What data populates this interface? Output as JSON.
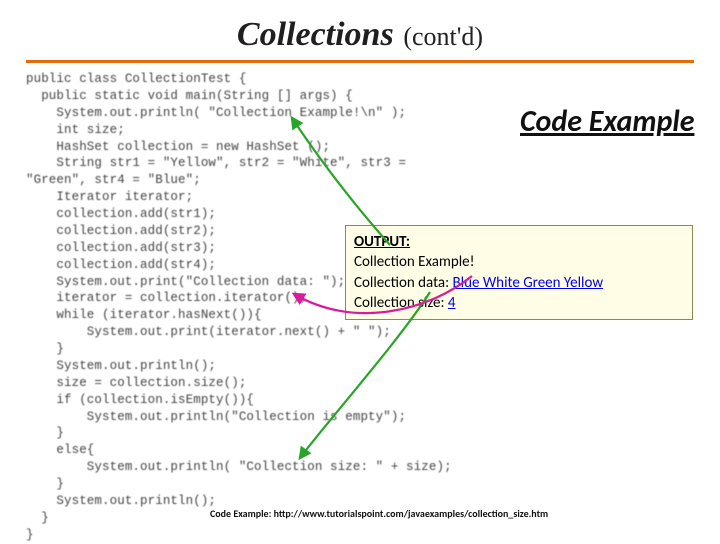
{
  "title": {
    "main": "Collections",
    "sub": "(cont'd)"
  },
  "heading_code_example": "Code\nExample",
  "code": "public class CollectionTest {\n  public static void main(String [] args) {\n    System.out.println( \"Collection Example!\\n\" );\n    int size;\n    HashSet collection = new HashSet ();\n    String str1 = \"Yellow\", str2 = \"White\", str3 =\n\"Green\", str4 = \"Blue\";\n    Iterator iterator;\n    collection.add(str1);\n    collection.add(str2);\n    collection.add(str3);\n    collection.add(str4);\n    System.out.print(\"Collection data: \");\n    iterator = collection.iterator();\n    while (iterator.hasNext()){\n        System.out.print(iterator.next() + \" \");\n    }\n    System.out.println();\n    size = collection.size();\n    if (collection.isEmpty()){\n        System.out.println(\"Collection is empty\");\n    }\n    else{\n        System.out.println( \"Collection size: \" + size);\n    }\n    System.out.println();\n  }\n}",
  "output": {
    "title": "OUTPUT:",
    "line1": "Collection Example!",
    "line2_prefix": "Collection data: ",
    "line2_data": "Blue White Green Yellow",
    "line3_prefix": "Collection size: ",
    "line3_data": "4"
  },
  "footer": {
    "label": "Code Example: ",
    "url": "http://www.tutorialspoint.com/javaexamples/collection_size.htm"
  }
}
